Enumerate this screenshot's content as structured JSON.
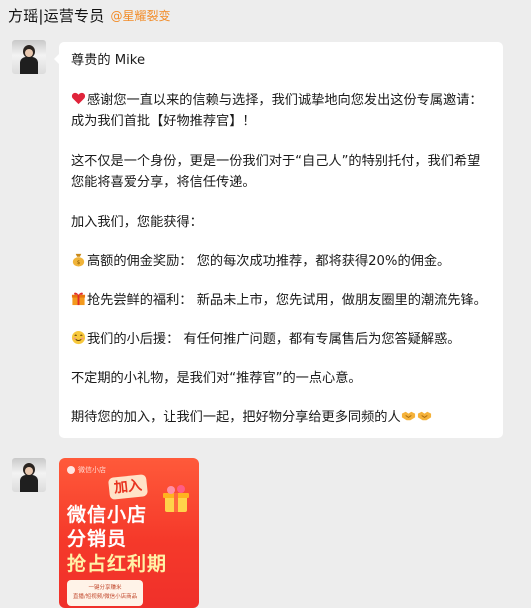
{
  "header": {
    "title": "方瑶|运营专员",
    "org": "@星耀裂变"
  },
  "message": {
    "greeting": "尊贵的 Mike",
    "p1": "感谢您一直以来的信赖与选择，我们诚挚地向您发出这份专属邀请：成为我们首批【好物推荐官】！",
    "p2": "这不仅是一个身份，更是一份我们对于“自己人”的特别托付，我们希望您能将喜爱分享，将信任传递。",
    "p3": "加入我们，您能获得：",
    "b1": "高额的佣金奖励： 您的每次成功推荐，都将获得20%的佣金。",
    "b2": "抢先尝鲜的福利： 新品未上市，您先试用，做朋友圈里的潮流先锋。",
    "b3": "我们的小后援： 有任何推广问题，都有专属售后为您答疑解惑。",
    "p4": "不定期的小礼物，是我们对“推荐官”的一点心意。",
    "p5": "期待您的加入，让我们一起，把好物分享给更多同频的人"
  },
  "icons": {
    "b0": "heart-icon",
    "b1": "money-bag-icon",
    "b2": "gift-icon",
    "b3": "smiling-face-icon",
    "end": "handshake-icon"
  },
  "card": {
    "brand": "微信小店",
    "join": "加入",
    "line1": "微信小店",
    "line2": "分销员",
    "line3": "抢占红利期",
    "foot1": "一键分享赚米",
    "foot2": "直播/短视频/微信小店商品"
  },
  "colors": {
    "background": "#ededed",
    "bubble": "#ffffff",
    "org": "#f28c28",
    "card_red": "#f5392a"
  }
}
